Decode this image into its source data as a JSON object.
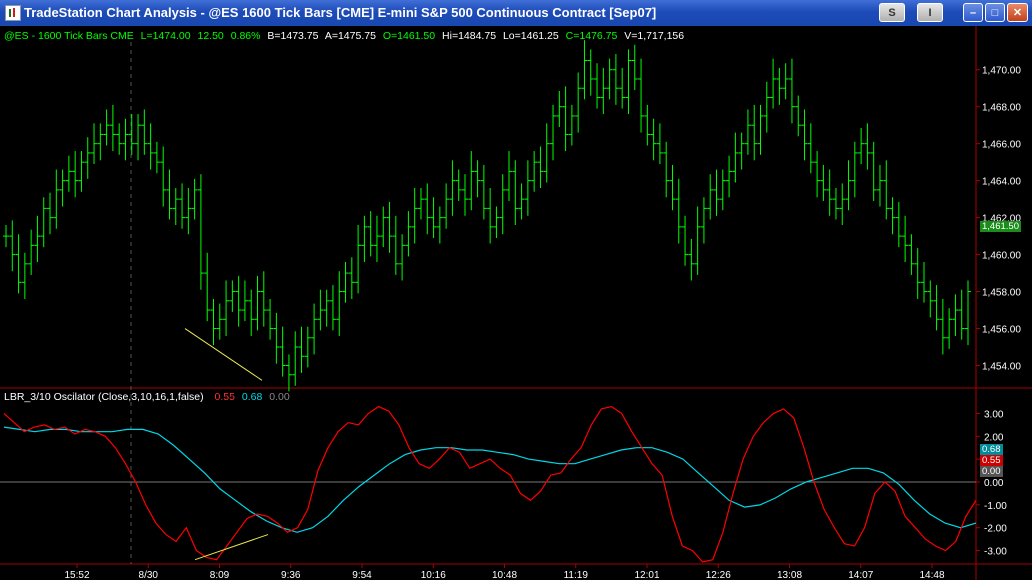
{
  "window": {
    "title": "TradeStation Chart Analysis - @ES  1600 Tick Bars [CME] E-mini S&P 500 Continuous Contract [Sep07]",
    "buttons": {
      "s": "S",
      "info": "I",
      "min": "–",
      "max": "□",
      "close": "✕"
    }
  },
  "price_header": {
    "symbol": "@ES - 1600 Tick Bars  CME",
    "last": "L=1474.00",
    "chg": "12.50",
    "pct": "0.86%",
    "bid": "B=1473.75",
    "ask": "A=1475.75",
    "open": "O=1461.50",
    "high": "Hi=1484.75",
    "low": "Lo=1461.25",
    "close": "C=1476.75",
    "volume": "V=1,717,156"
  },
  "osc_header": {
    "name": "LBR_3/10 Oscilator (Close,3,10,16,1,false)",
    "fast": "0.55",
    "slow": "0.68",
    "zero": "0.00"
  },
  "price_axis": [
    "1,470.00",
    "1,468.00",
    "1,466.00",
    "1,464.00",
    "1,462.00",
    "1,460.00",
    "1,458.00",
    "1,456.00",
    "1,454.00"
  ],
  "osc_axis": [
    "3.00",
    "2.00",
    "1.00",
    "0.00",
    "-1.00",
    "-2.00",
    "-3.00"
  ],
  "price_tag": "1,461.50",
  "osc_tags": {
    "fast": "0.55",
    "slow": "0.68",
    "zero": "0.00"
  },
  "time_axis": [
    "15:52",
    "8/30",
    "8:09",
    "9:36",
    "9:54",
    "10:16",
    "10:48",
    "11:19",
    "12:01",
    "12:26",
    "13:08",
    "14:07",
    "14:48"
  ],
  "colors": {
    "bars": "#00ff00",
    "fast": "#ff0000",
    "slow": "#00d8e8",
    "trend": "#e8e850",
    "axis": "#aa0000"
  },
  "chart_data": {
    "type": "line",
    "x_labels": [
      "15:52",
      "8/30",
      "8:09",
      "9:36",
      "9:54",
      "10:16",
      "10:48",
      "11:19",
      "12:01",
      "12:26",
      "13:08",
      "14:07",
      "14:48"
    ],
    "price_closes": [
      1461.0,
      1460.0,
      1458.5,
      1459.5,
      1460.5,
      1461.0,
      1462.5,
      1462.0,
      1463.5,
      1464.0,
      1464.5,
      1464.0,
      1465.0,
      1465.5,
      1466.0,
      1466.5,
      1467.0,
      1466.5,
      1466.0,
      1466.5,
      1466.0,
      1467.0,
      1466.0,
      1465.5,
      1465.0,
      1463.5,
      1462.5,
      1463.0,
      1462.0,
      1462.5,
      1463.5,
      1459.0,
      1457.0,
      1456.0,
      1456.5,
      1457.5,
      1458.0,
      1457.0,
      1457.5,
      1456.5,
      1458.0,
      1457.0,
      1456.0,
      1455.0,
      1454.0,
      1453.5,
      1455.0,
      1454.5,
      1455.5,
      1456.5,
      1457.0,
      1457.5,
      1456.5,
      1458.0,
      1459.0,
      1458.5,
      1460.5,
      1461.5,
      1460.5,
      1461.0,
      1462.0,
      1461.0,
      1459.5,
      1460.5,
      1461.5,
      1462.5,
      1463.0,
      1462.0,
      1461.5,
      1462.0,
      1463.0,
      1464.0,
      1463.5,
      1463.0,
      1464.5,
      1464.0,
      1462.5,
      1461.5,
      1462.0,
      1463.5,
      1464.5,
      1462.5,
      1463.0,
      1464.0,
      1465.0,
      1464.5,
      1466.0,
      1467.5,
      1468.0,
      1466.5,
      1467.5,
      1469.0,
      1470.5,
      1469.5,
      1468.5,
      1469.0,
      1470.0,
      1469.0,
      1468.5,
      1470.5,
      1469.5,
      1467.5,
      1466.5,
      1466.0,
      1465.5,
      1464.0,
      1463.0,
      1461.5,
      1460.0,
      1459.5,
      1461.5,
      1462.5,
      1463.5,
      1463.0,
      1464.0,
      1464.5,
      1465.5,
      1466.0,
      1467.0,
      1466.0,
      1467.5,
      1468.5,
      1469.5,
      1469.0,
      1469.5,
      1468.0,
      1467.0,
      1466.0,
      1465.0,
      1464.0,
      1463.5,
      1463.0,
      1462.5,
      1463.0,
      1464.0,
      1465.5,
      1466.0,
      1465.5,
      1463.5,
      1464.0,
      1462.5,
      1462.0,
      1461.0,
      1460.5,
      1459.5,
      1458.5,
      1458.0,
      1457.5,
      1456.5,
      1455.5,
      1456.5,
      1457.0,
      1456.0,
      1458.0
    ],
    "osc_fast": [
      3.0,
      2.6,
      2.2,
      2.4,
      2.5,
      2.3,
      2.4,
      2.1,
      2.3,
      2.2,
      2.0,
      1.5,
      0.8,
      0.0,
      -1.0,
      -1.8,
      -2.3,
      -2.6,
      -2.0,
      -3.0,
      -3.3,
      -3.4,
      -2.8,
      -2.2,
      -1.6,
      -1.4,
      -1.5,
      -1.8,
      -2.2,
      -2.0,
      -1.2,
      0.5,
      1.5,
      2.2,
      2.6,
      2.5,
      3.0,
      3.3,
      3.1,
      2.5,
      1.5,
      0.8,
      0.6,
      1.0,
      1.5,
      1.3,
      0.6,
      0.8,
      1.0,
      0.6,
      0.3,
      -0.5,
      -0.8,
      -0.4,
      0.3,
      0.4,
      1.0,
      1.5,
      2.5,
      3.2,
      3.3,
      3.0,
      2.2,
      1.5,
      0.8,
      0.3,
      -1.5,
      -2.8,
      -3.0,
      -3.5,
      -3.4,
      -2.2,
      -0.5,
      1.0,
      2.0,
      2.6,
      3.0,
      3.2,
      2.8,
      1.5,
      0.0,
      -1.2,
      -2.0,
      -2.7,
      -2.8,
      -2.0,
      -0.5,
      0.0,
      -0.4,
      -1.5,
      -2.0,
      -2.5,
      -2.8,
      -3.0,
      -2.6,
      -1.5,
      -0.8
    ],
    "osc_slow": [
      2.4,
      2.3,
      2.2,
      2.3,
      2.3,
      2.2,
      2.2,
      2.2,
      2.3,
      2.3,
      2.1,
      1.6,
      1.0,
      0.4,
      -0.3,
      -0.8,
      -1.3,
      -1.7,
      -2.0,
      -2.2,
      -2.0,
      -1.5,
      -0.8,
      -0.2,
      0.3,
      0.8,
      1.2,
      1.4,
      1.5,
      1.5,
      1.4,
      1.4,
      1.3,
      1.2,
      1.0,
      0.9,
      0.8,
      0.8,
      1.0,
      1.2,
      1.4,
      1.5,
      1.5,
      1.3,
      1.0,
      0.4,
      -0.2,
      -0.8,
      -1.1,
      -1.0,
      -0.7,
      -0.3,
      0.0,
      0.2,
      0.4,
      0.6,
      0.6,
      0.4,
      -0.1,
      -0.8,
      -1.4,
      -1.8,
      -2.0,
      -1.8
    ],
    "price_ylim": [
      1453,
      1471.5
    ],
    "osc_ylim": [
      -3.5,
      3.5
    ],
    "grid": false
  }
}
